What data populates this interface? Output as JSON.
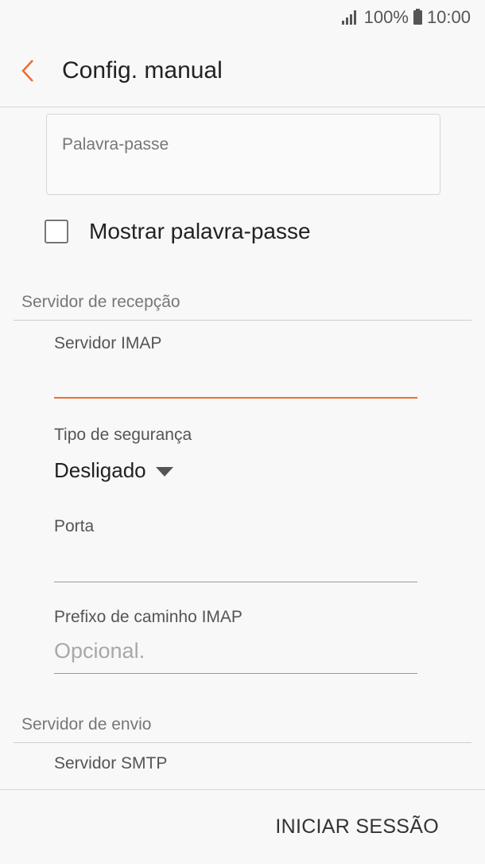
{
  "status_bar": {
    "battery": "100%",
    "time": "10:00"
  },
  "app_bar": {
    "title": "Config. manual"
  },
  "form": {
    "password_label": "Palavra-passe",
    "show_password_label": "Mostrar palavra-passe",
    "incoming_section": "Servidor de recepção",
    "imap_server_label": "Servidor IMAP",
    "imap_server_value": "",
    "security_type_label": "Tipo de segurança",
    "security_type_value": "Desligado",
    "port_label": "Porta",
    "port_value": "",
    "imap_prefix_label": "Prefixo de caminho IMAP",
    "imap_prefix_placeholder": "Opcional.",
    "outgoing_section": "Servidor de envio",
    "smtp_server_label": "Servidor SMTP"
  },
  "footer": {
    "sign_in_label": "INICIAR SESSÃO"
  },
  "colors": {
    "accent": "#f06d2f"
  }
}
